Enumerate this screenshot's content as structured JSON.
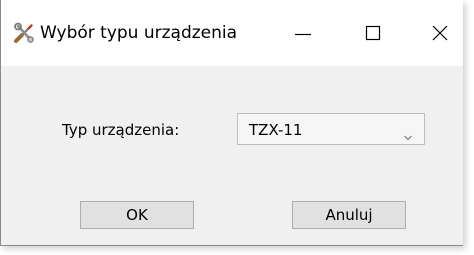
{
  "window": {
    "title": "Wybór typu urządzenia",
    "app_icon": "tools-icon"
  },
  "titlebar_controls": {
    "minimize_icon": "minimize-icon",
    "maximize_icon": "maximize-icon",
    "close_icon": "close-icon"
  },
  "form": {
    "device_type_label": "Typ urządzenia:",
    "device_type_value": "TZX-11",
    "dropdown_icon": "chevron-down-icon"
  },
  "buttons": {
    "ok_label": "OK",
    "cancel_label": "Anuluj"
  },
  "colors": {
    "window_background": "#f0f0f0",
    "titlebar_background": "#ffffff",
    "button_background": "#e1e1e1",
    "button_border": "#adadad"
  }
}
